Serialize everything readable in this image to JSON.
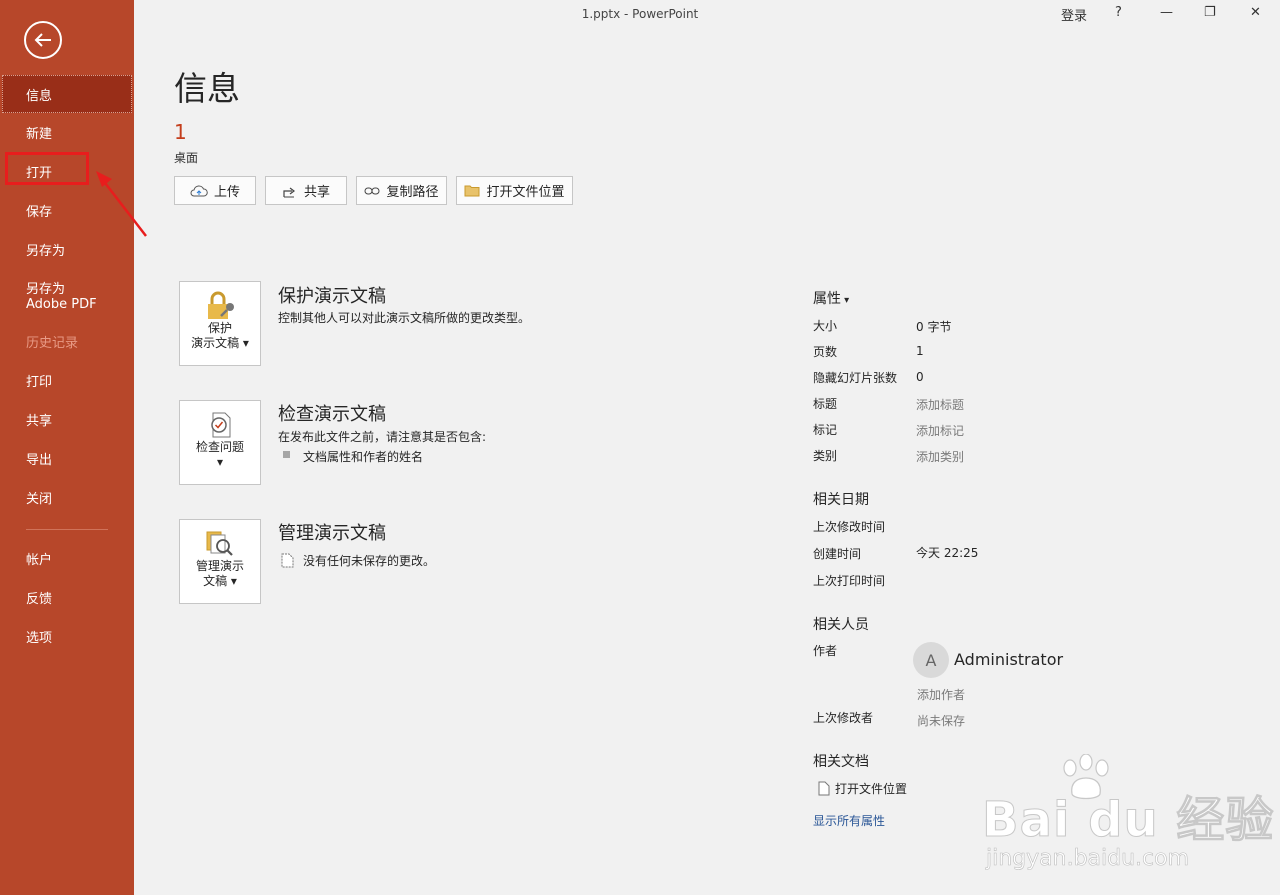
{
  "window": {
    "title": "1.pptx  -  PowerPoint",
    "sign_in": "登录",
    "help": "?",
    "minimize": "—",
    "restore": "❐",
    "close": "✕"
  },
  "sidebar": {
    "items": [
      {
        "label": "信息"
      },
      {
        "label": "新建"
      },
      {
        "label": "打开"
      },
      {
        "label": "保存"
      },
      {
        "label": "另存为"
      },
      {
        "label": "另存为 Adobe PDF"
      },
      {
        "label": "历史记录"
      },
      {
        "label": "打印"
      },
      {
        "label": "共享"
      },
      {
        "label": "导出"
      },
      {
        "label": "关闭"
      },
      {
        "label": "帐户"
      },
      {
        "label": "反馈"
      },
      {
        "label": "选项"
      }
    ]
  },
  "main": {
    "title": "信息",
    "doc_name": "1",
    "doc_location": "桌面",
    "actions": [
      {
        "label": "上传",
        "icon": "cloud-upload-icon"
      },
      {
        "label": "共享",
        "icon": "share-icon"
      },
      {
        "label": "复制路径",
        "icon": "link-icon"
      },
      {
        "label": "打开文件位置",
        "icon": "folder-icon"
      }
    ],
    "sections": [
      {
        "tile_line1": "保护",
        "tile_line2": "演示文稿",
        "title": "保护演示文稿",
        "desc": "控制其他人可以对此演示文稿所做的更改类型。"
      },
      {
        "tile_line1": "检查问题",
        "tile_line2": "",
        "title": "检查演示文稿",
        "desc": "在发布此文件之前，请注意其是否包含:",
        "bullet": "文档属性和作者的姓名"
      },
      {
        "tile_line1": "管理演示",
        "tile_line2": "文稿",
        "title": "管理演示文稿",
        "desc": "没有任何未保存的更改。"
      }
    ]
  },
  "properties": {
    "heading": "属性",
    "rows": [
      {
        "label": "大小",
        "value": "0 字节"
      },
      {
        "label": "页数",
        "value": "1"
      },
      {
        "label": "隐藏幻灯片张数",
        "value": "0"
      },
      {
        "label": "标题",
        "value": "添加标题"
      },
      {
        "label": "标记",
        "value": "添加标记"
      },
      {
        "label": "类别",
        "value": "添加类别"
      }
    ],
    "dates_heading": "相关日期",
    "dates": [
      {
        "label": "上次修改时间",
        "value": ""
      },
      {
        "label": "创建时间",
        "value": "今天 22:25"
      },
      {
        "label": "上次打印时间",
        "value": ""
      }
    ],
    "people_heading": "相关人员",
    "author_label": "作者",
    "author_initial": "A",
    "author_name": "Administrator",
    "add_author": "添加作者",
    "last_modified_by_label": "上次修改者",
    "last_modified_by_value": "尚未保存",
    "docs_heading": "相关文档",
    "open_file_location": "打开文件位置",
    "show_all": "显示所有属性"
  },
  "watermark": {
    "main": "Bai  du 经验",
    "sub": "jingyan.baidu.com"
  },
  "colors": {
    "sidebar": "#b7472a",
    "sidebar_active": "#992e18",
    "accent": "#c43e1c",
    "highlight": "#e81d1d",
    "link": "#2b5797"
  }
}
